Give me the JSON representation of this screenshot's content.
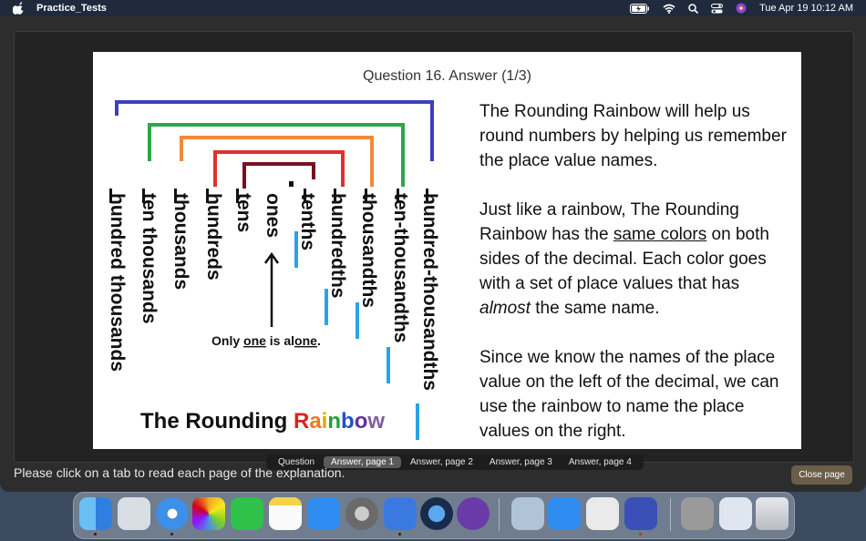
{
  "menubar": {
    "app_name": "Practice_Tests",
    "clock": "Tue Apr 19  10:12 AM",
    "icons": [
      "apple-icon",
      "battery-charging-icon",
      "wifi-icon",
      "search-icon",
      "control-center-icon",
      "siri-icon"
    ]
  },
  "slide": {
    "title": "Question 16. Answer (1/3)",
    "left_places": [
      "hundred thousands",
      "ten thousands",
      "thousands",
      "hundreds",
      "tens",
      "ones"
    ],
    "right_places": [
      "tenths",
      "hundredths",
      "thousandths",
      "ten-thousandths",
      "hundred-thousandths"
    ],
    "alone_note": {
      "pre": "Only ",
      "one": "one",
      "mid": " is al",
      "one2": "one",
      "post": "."
    },
    "rainbow_title_prefix": "The Rounding ",
    "rainbow_letters": [
      "R",
      "a",
      "i",
      "n",
      "b",
      "o",
      "w"
    ],
    "rainbow_colors": {
      "blue": "#3f3fbf",
      "green": "#2aa84a",
      "orange": "#f08a3c",
      "red": "#e03030",
      "maroon": "#7a1020",
      "marker": "#29a3e6"
    },
    "letter_colors": [
      "#e02020",
      "#f07820",
      "#d0b000",
      "#20a040",
      "#2050d0",
      "#6030a0",
      "#8060a0"
    ],
    "paragraph1": "The Rounding Rainbow will help us round numbers by helping us remember the place value names.",
    "paragraph2": {
      "a": "Just like a rainbow, The Rounding Rainbow has the ",
      "u": "same colors",
      "b": " on both sides of the decimal. Each color goes with a set of place values that has ",
      "i": "almost",
      "c": " the same name."
    },
    "paragraph3": "Since we know the names of the place value on the left of the decimal, we can use the rainbow to name the place values on the right."
  },
  "tabs": [
    {
      "label": "Question",
      "active": false
    },
    {
      "label": "Answer, page 1",
      "active": true
    },
    {
      "label": "Answer, page 2",
      "active": false
    },
    {
      "label": "Answer, page 3",
      "active": false
    },
    {
      "label": "Answer, page 4",
      "active": false
    }
  ],
  "instructions": "Please click on a tab to read each page of the explanation.",
  "close_label": "Close page",
  "dock": {
    "apps": [
      {
        "name": "finder-icon",
        "color": "#2f8fe8"
      },
      {
        "name": "launchpad-icon",
        "color": "#d9dde4"
      },
      {
        "name": "safari-icon",
        "color": "#3d8fe8"
      },
      {
        "name": "photos-icon",
        "color": "#f2f2f2"
      },
      {
        "name": "facetime-icon",
        "color": "#2fc24a"
      },
      {
        "name": "notes-icon",
        "color": "#f4d24a"
      },
      {
        "name": "app-store-icon",
        "color": "#2f8cf0"
      },
      {
        "name": "system-preferences-icon",
        "color": "#8a8a8a"
      },
      {
        "name": "xcode-icon",
        "color": "#3a7ae0"
      },
      {
        "name": "quicktime-icon",
        "color": "#2a3a5a"
      },
      {
        "name": "imovie-icon",
        "color": "#6a3aa8"
      },
      {
        "name": "preview-icon",
        "color": "#b0c4d8"
      },
      {
        "name": "instruments-icon",
        "color": "#2f8cf0"
      },
      {
        "name": "textedit-icon",
        "color": "#eaeaea"
      },
      {
        "name": "calculator-icon",
        "color": "#3a50b8"
      },
      {
        "name": "printer-icon",
        "color": "#9a9a9a"
      },
      {
        "name": "finder-window-icon",
        "color": "#dfe6ef"
      },
      {
        "name": "trash-icon",
        "color": "#c8ccd2"
      }
    ]
  }
}
